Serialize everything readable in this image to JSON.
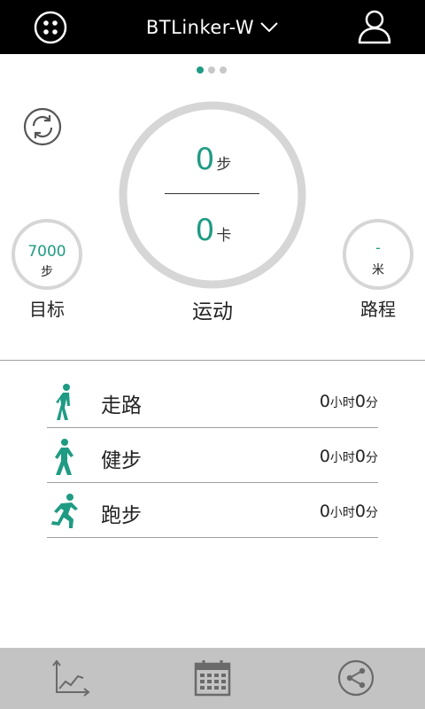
{
  "header": {
    "device_name": "BTLinker-W",
    "menu_icon": "apps-dots-icon",
    "dropdown_icon": "chevron-down-icon",
    "user_icon": "user-icon"
  },
  "pager": {
    "pages": 3,
    "active": 0
  },
  "summary": {
    "steps_value": "0",
    "steps_unit": "步",
    "calories_value": "0",
    "calories_unit": "卡",
    "label": "运动"
  },
  "goal": {
    "value": "7000",
    "unit": "步",
    "label": "目标"
  },
  "distance": {
    "value": "-",
    "unit": "米",
    "label": "路程"
  },
  "activities": [
    {
      "name": "走路",
      "hours": "0",
      "hour_unit": "小时",
      "minutes": "0",
      "minute_unit": "分",
      "icon": "walking-icon"
    },
    {
      "name": "健步",
      "hours": "0",
      "hour_unit": "小时",
      "minutes": "0",
      "minute_unit": "分",
      "icon": "brisk-walk-icon"
    },
    {
      "name": "跑步",
      "hours": "0",
      "hour_unit": "小时",
      "minutes": "0",
      "minute_unit": "分",
      "icon": "running-icon"
    }
  ],
  "bottom_nav": [
    {
      "icon": "line-chart-icon"
    },
    {
      "icon": "calendar-icon"
    },
    {
      "icon": "share-icon"
    }
  ],
  "colors": {
    "accent": "#1f9b83",
    "header_bg": "#000000",
    "nav_bg": "#c3c3c3",
    "ring": "#d6d6d6"
  }
}
